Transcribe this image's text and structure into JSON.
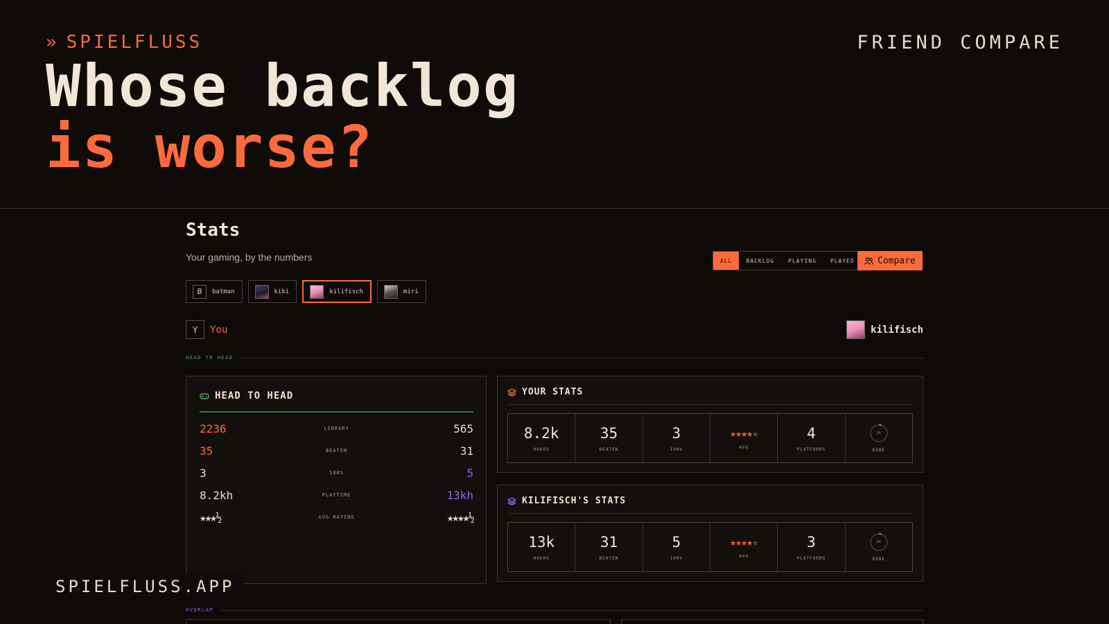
{
  "brand": {
    "chevrons": "»",
    "name": "SPIELFLUSS"
  },
  "header": {
    "friend_compare": "FRIEND COMPARE"
  },
  "headline": {
    "line1": "Whose backlog",
    "line2": "is worse?"
  },
  "stats": {
    "title": "Stats",
    "subtitle": "Your gaming, by the numbers"
  },
  "filters": [
    "ALL",
    "BACKLOG",
    "PLAYING",
    "PLAYED"
  ],
  "compare_label": "Compare",
  "friends": [
    {
      "name": "batman",
      "initial": "B"
    },
    {
      "name": "kiki",
      "initial": ""
    },
    {
      "name": "kilifisch",
      "initial": ""
    },
    {
      "name": "miri",
      "initial": ""
    }
  ],
  "you": {
    "initial": "Y",
    "label": "You"
  },
  "opponent": {
    "name": "kilifisch"
  },
  "sections": {
    "head_to_head": "HEAD TO HEAD",
    "overlap": "OVERLAP"
  },
  "h2h": {
    "title": "HEAD TO HEAD",
    "rows": [
      {
        "left": "2236",
        "label": "LIBRARY",
        "right": "565"
      },
      {
        "left": "35",
        "label": "BEATEN",
        "right": "31"
      },
      {
        "left": "3",
        "label": "100%",
        "right": "5"
      },
      {
        "left": "8.2kh",
        "label": "PLAYTIME",
        "right": "13kh"
      },
      {
        "left": "★★★½",
        "label": "AVG RATING",
        "right": "★★★★½"
      }
    ]
  },
  "your_stats": {
    "title": "YOUR STATS",
    "hours": "8.2k",
    "hours_label": "HOURS",
    "beaten": "35",
    "beaten_label": "BEATEN",
    "complete": "3",
    "complete_label": "100%",
    "avg_rating": 3.5,
    "avg_label": "AVG",
    "platforms": "4",
    "platforms_label": "PLATFORMS",
    "done": "2%",
    "done_label": "DONE"
  },
  "kil_stats": {
    "title": "KILIFISCH'S STATS",
    "hours": "13k",
    "hours_label": "HOURS",
    "beaten": "31",
    "beaten_label": "BEATEN",
    "complete": "5",
    "complete_label": "100%",
    "avg_rating": 4,
    "avg_label": "AVG",
    "platforms": "3",
    "platforms_label": "PLATFORMS",
    "done": "5%",
    "done_label": "DONE"
  },
  "footer": {
    "domain": "SPIELFLUSS.APP"
  },
  "colors": {
    "accent": "#ff6a3d",
    "opponent": "#8a6cf0",
    "positive": "#4ea86a",
    "background": "#0d0a08"
  }
}
